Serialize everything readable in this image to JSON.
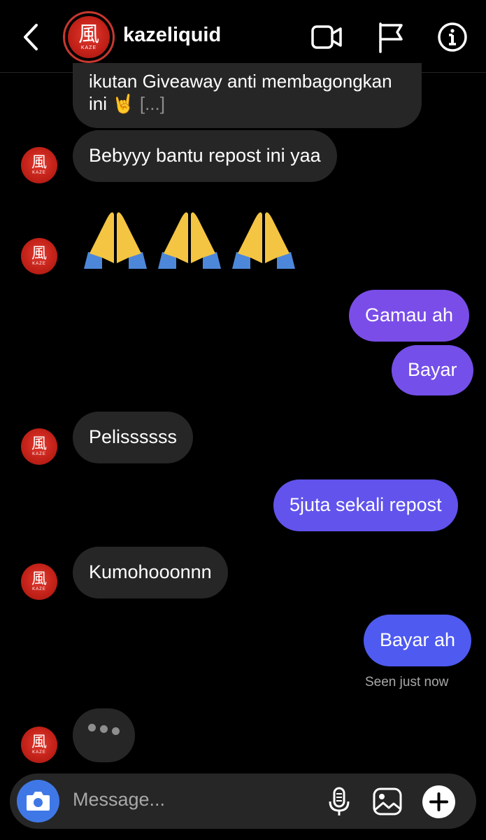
{
  "header": {
    "username": "kazeliquid",
    "avatar_kanji": "風",
    "avatar_brand": "KAZE",
    "icons": [
      "back-icon",
      "video-call-icon",
      "flag-icon",
      "info-icon"
    ]
  },
  "colors": {
    "background": "#000000",
    "incoming_bubble": "#262626",
    "outgoing_gradient_top": "#7c4ce8",
    "outgoing_gradient_bottom": "#4b5bf0",
    "camera_button": "#3f78e6"
  },
  "messages": {
    "quoted": {
      "text": "ikutan Giveaway anti membagongkan",
      "text2": "ini 🤘",
      "ellipsis": "[...]"
    },
    "m1": "Bebyyy bantu repost ini yaa",
    "emoji": "🙏🙏🙏",
    "m2": "Gamau ah",
    "m3": "Bayar",
    "m4": "Pelissssss",
    "m5": "5juta sekali repost",
    "m6": "Kumohooonnn",
    "m7": "Bayar ah",
    "seen": "Seen just now"
  },
  "composer": {
    "placeholder": "Message...",
    "icons": [
      "camera-icon",
      "microphone-icon",
      "gallery-icon",
      "plus-icon"
    ]
  }
}
